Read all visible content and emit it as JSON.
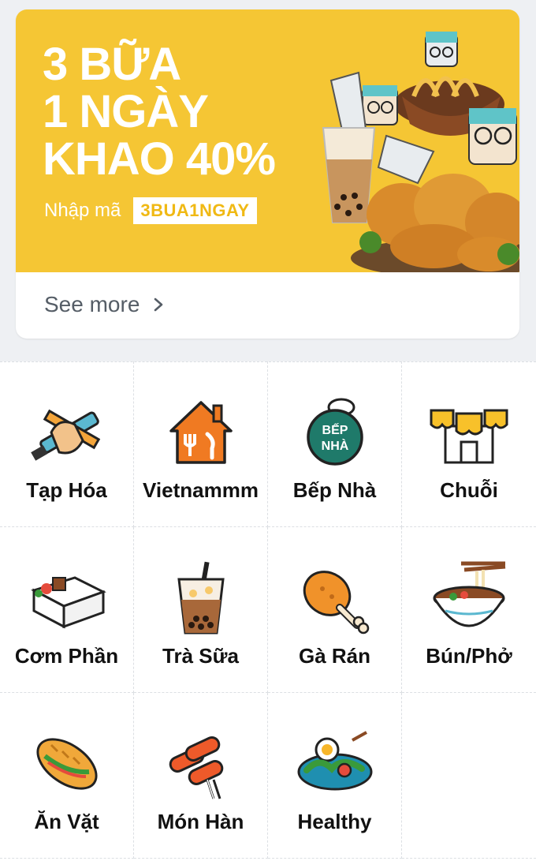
{
  "promo": {
    "headline_line1": "3 BỮA",
    "headline_line2": "1 NGÀY",
    "headline_line3": "KHAO 40%",
    "code_label": "Nhập mã",
    "code": "3BUA1NGAY",
    "see_more": "See more",
    "colors": {
      "banner": "#f5c634",
      "text": "#ffffff"
    }
  },
  "categories": [
    {
      "label": "Tạp Hóa",
      "icon": "grocery-icon"
    },
    {
      "label": "Vietnammm",
      "icon": "home-kitchen-icon"
    },
    {
      "label": "Bếp Nhà",
      "icon": "bep-nha-badge-icon"
    },
    {
      "label": "Chuỗi",
      "icon": "chain-store-icon"
    },
    {
      "label": "Cơm Phần",
      "icon": "bento-box-icon"
    },
    {
      "label": "Trà Sữa",
      "icon": "milk-tea-icon"
    },
    {
      "label": "Gà Rán",
      "icon": "fried-chicken-icon"
    },
    {
      "label": "Bún/Phở",
      "icon": "noodle-bowl-icon"
    },
    {
      "label": "Ăn Vặt",
      "icon": "banh-mi-icon"
    },
    {
      "label": "Món Hàn",
      "icon": "tteokbokki-icon"
    },
    {
      "label": "Healthy",
      "icon": "salad-icon"
    }
  ],
  "icon_badge_text": {
    "line1": "BẾP",
    "line2": "NHÀ"
  }
}
